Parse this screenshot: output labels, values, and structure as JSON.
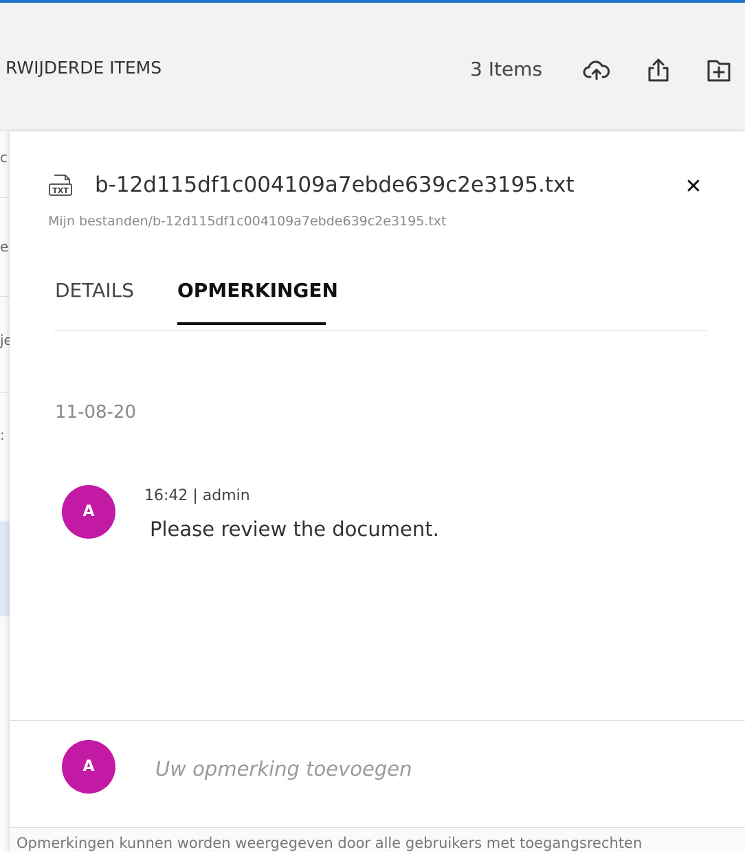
{
  "toolbar": {
    "title": "RWIJDERDE ITEMS",
    "item_count": "3 Items",
    "icons": [
      "cloud-upload-icon",
      "share-upload-icon",
      "new-folder-icon"
    ]
  },
  "left_strip": {
    "chars": [
      "c",
      "e",
      "je",
      ":"
    ]
  },
  "details_panel": {
    "file_icon_label": "TXT",
    "file_name": "b-12d115df1c004109a7ebde639c2e3195.txt",
    "file_path": "Mijn bestanden/b-12d115df1c004109a7ebde639c2e3195.txt",
    "close_label": "✕",
    "tabs": [
      {
        "label": "DETAILS",
        "active": false
      },
      {
        "label": "OPMERKINGEN",
        "active": true
      }
    ],
    "comments_date": "11-08-20",
    "comments": [
      {
        "avatar_initial": "A",
        "meta": "16:42  |  admin",
        "text": "Please review the document."
      }
    ],
    "compose": {
      "avatar_initial": "A",
      "placeholder": "Uw opmerking toevoegen"
    },
    "footer_note": "Opmerkingen kunnen worden weergegeven door alle gebruikers met toegangsrechten"
  },
  "colors": {
    "accent_bar": "#1a73c8",
    "avatar": "#c21aa5",
    "toolbar_bg": "#f1f2f4"
  }
}
